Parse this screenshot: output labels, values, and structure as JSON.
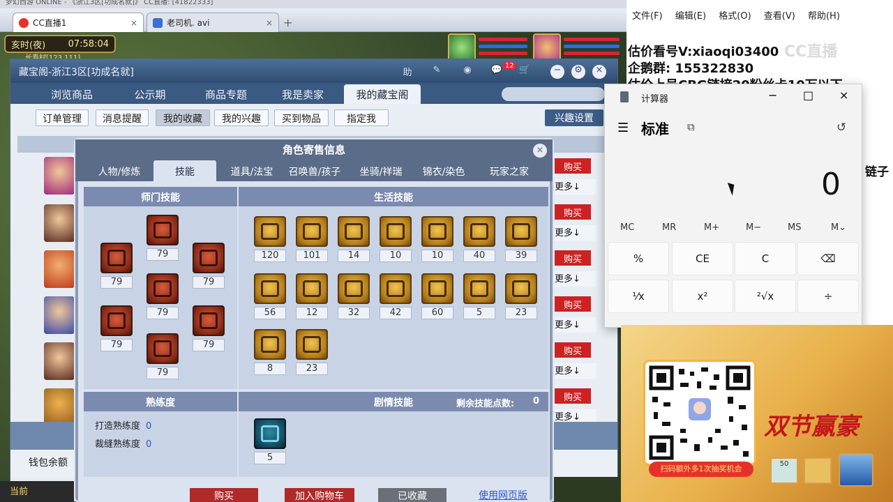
{
  "browser": {
    "top_strip": "梦幻西游 ONLINE  - 《浙江3区[功成名就]》  CC直播: [41822333]",
    "tabs": [
      {
        "label": "CC直播1",
        "close": "×"
      },
      {
        "label": "老司机. avi",
        "close": "×"
      }
    ],
    "new_tab": "+"
  },
  "game": {
    "time": "亥时(夜)",
    "clock": "07:58:04",
    "location": "长寿村[123,111]"
  },
  "cbg": {
    "title": "藏宝阁-浙江3区[功成名就]",
    "title_icons": [
      "助",
      "✎",
      "◉",
      "💬",
      "🛒"
    ],
    "message_count": "12",
    "window_buttons": [
      "−",
      "⚙",
      "×"
    ],
    "tabs": [
      "浏览商品",
      "公示期",
      "商品专题",
      "我是卖家",
      "我的藏宝阁"
    ],
    "active_tab": 4,
    "subnav": [
      "订单管理",
      "消息提醒",
      "我的收藏",
      "我的兴趣",
      "买到物品",
      "指定我"
    ],
    "interest_button": "兴趣设置",
    "list": {
      "buy_label": "购买",
      "more_label": "更多↓",
      "rows": 6
    },
    "wallet_label": "钱包余额"
  },
  "dialog": {
    "title": "角色寄售信息",
    "close": "×",
    "tabs": [
      "人物/修炼",
      "技能",
      "道具/法宝",
      "召唤兽/孩子",
      "坐骑/祥瑞",
      "锦衣/染色",
      "玩家之家"
    ],
    "active_tab": 1,
    "school_section": "师门技能",
    "life_section": "生活技能",
    "school_skills": [
      "79",
      "79",
      "79",
      "79",
      "79",
      "79",
      "79"
    ],
    "life_skills": [
      "120",
      "101",
      "14",
      "10",
      "10",
      "40",
      "39",
      "56",
      "12",
      "32",
      "42",
      "60",
      "5",
      "23",
      "8",
      "23"
    ],
    "proficiency_section": "熟练度",
    "proficiency": [
      {
        "label": "打造熟练度",
        "value": "0"
      },
      {
        "label": "裁缝熟练度",
        "value": "0"
      }
    ],
    "story_section": "剧情技能",
    "remaining_label": "剩余技能点数:",
    "remaining_value": "0",
    "story_skills": [
      "5"
    ],
    "bottom_buttons": [
      "购买",
      "加入购物车",
      "已收藏"
    ],
    "web_link": "使用网页版"
  },
  "notepad": {
    "menu": [
      "文件(F)",
      "编辑(E)",
      "格式(O)",
      "查看(V)",
      "帮助(H)"
    ],
    "lines": [
      "估价看号V:xiaoqi03400",
      "企鹅群: 155322830",
      "估价上号CBG链接20粉丝卡10万以下"
    ],
    "overflow_text": "链子",
    "watermark": "CC直播"
  },
  "calculator": {
    "app_title": "计算器",
    "mode": "标准",
    "display": "0",
    "memory": [
      "MC",
      "MR",
      "M+",
      "M−",
      "MS",
      "M⌄"
    ],
    "row1": [
      "%",
      "CE",
      "C",
      "⌫"
    ],
    "row2": [
      "⅟x",
      "x²",
      "²√x",
      "÷"
    ],
    "window_buttons": [
      "−",
      "□",
      "×"
    ]
  },
  "ad": {
    "promo": "扫码额外多1次抽奖机会",
    "headline": "双节赢豪",
    "badge": "50"
  },
  "taskbar": {
    "label": "当前"
  }
}
